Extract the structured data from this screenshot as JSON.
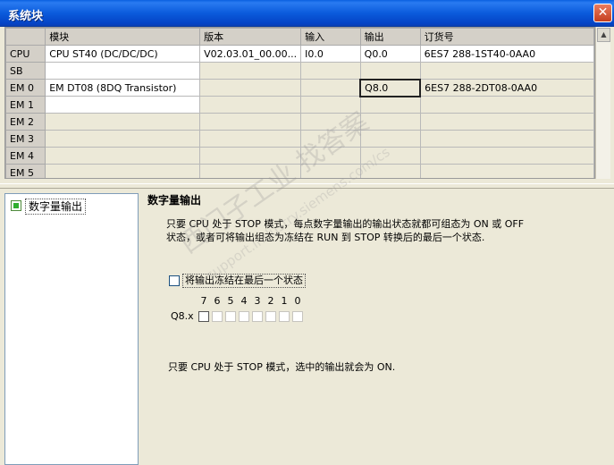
{
  "window": {
    "title": "系统块",
    "close_glyph": "✕"
  },
  "table": {
    "headers": [
      "",
      "模块",
      "版本",
      "输入",
      "输出",
      "订货号"
    ],
    "rows": [
      {
        "label": "CPU",
        "module": "CPU ST40 (DC/DC/DC)",
        "version": "V02.03.01_00.00...",
        "input": "I0.0",
        "output": "Q0.0",
        "order": "6ES7 288-1ST40-0AA0"
      },
      {
        "label": "SB",
        "module": "",
        "version": "",
        "input": "",
        "output": "",
        "order": ""
      },
      {
        "label": "EM 0",
        "module": "EM DT08 (8DQ Transistor)",
        "version": "",
        "input": "",
        "output": "Q8.0",
        "order": "6ES7 288-2DT08-0AA0"
      },
      {
        "label": "EM 1",
        "module": "",
        "version": "",
        "input": "",
        "output": "",
        "order": ""
      },
      {
        "label": "EM 2",
        "module": "",
        "version": "",
        "input": "",
        "output": "",
        "order": ""
      },
      {
        "label": "EM 3",
        "module": "",
        "version": "",
        "input": "",
        "output": "",
        "order": ""
      },
      {
        "label": "EM 4",
        "module": "",
        "version": "",
        "input": "",
        "output": "",
        "order": ""
      },
      {
        "label": "EM 5",
        "module": "",
        "version": "",
        "input": "",
        "output": "",
        "order": ""
      }
    ]
  },
  "tree": {
    "items": [
      {
        "label": "数字量输出",
        "icon": "digital-output-icon"
      }
    ]
  },
  "panel": {
    "title": "数字量输出",
    "desc_line1": "只要 CPU 处于 STOP 模式，每点数字量输出的输出状态就都可组态为 ON 或 OFF",
    "desc_line2": "状态，或者可将输出组态为冻结在 RUN 到 STOP 转换后的最后一个状态.",
    "freeze_checkbox_label": "将输出冻结在最后一个状态",
    "freeze_checked": false,
    "bit_numbers": [
      "7",
      "6",
      "5",
      "4",
      "3",
      "2",
      "1",
      "0"
    ],
    "byte_label": "Q8.x",
    "note": "只要 CPU 处于 STOP 模式，选中的输出就会为 ON."
  },
  "watermark": {
    "text1": "西门子工业  找答案",
    "text2": "support.industry.siemens.com/cs"
  },
  "colors": {
    "titlebar": "#0b5bdc",
    "close_button": "#c4401f",
    "background": "#ece9d8"
  }
}
